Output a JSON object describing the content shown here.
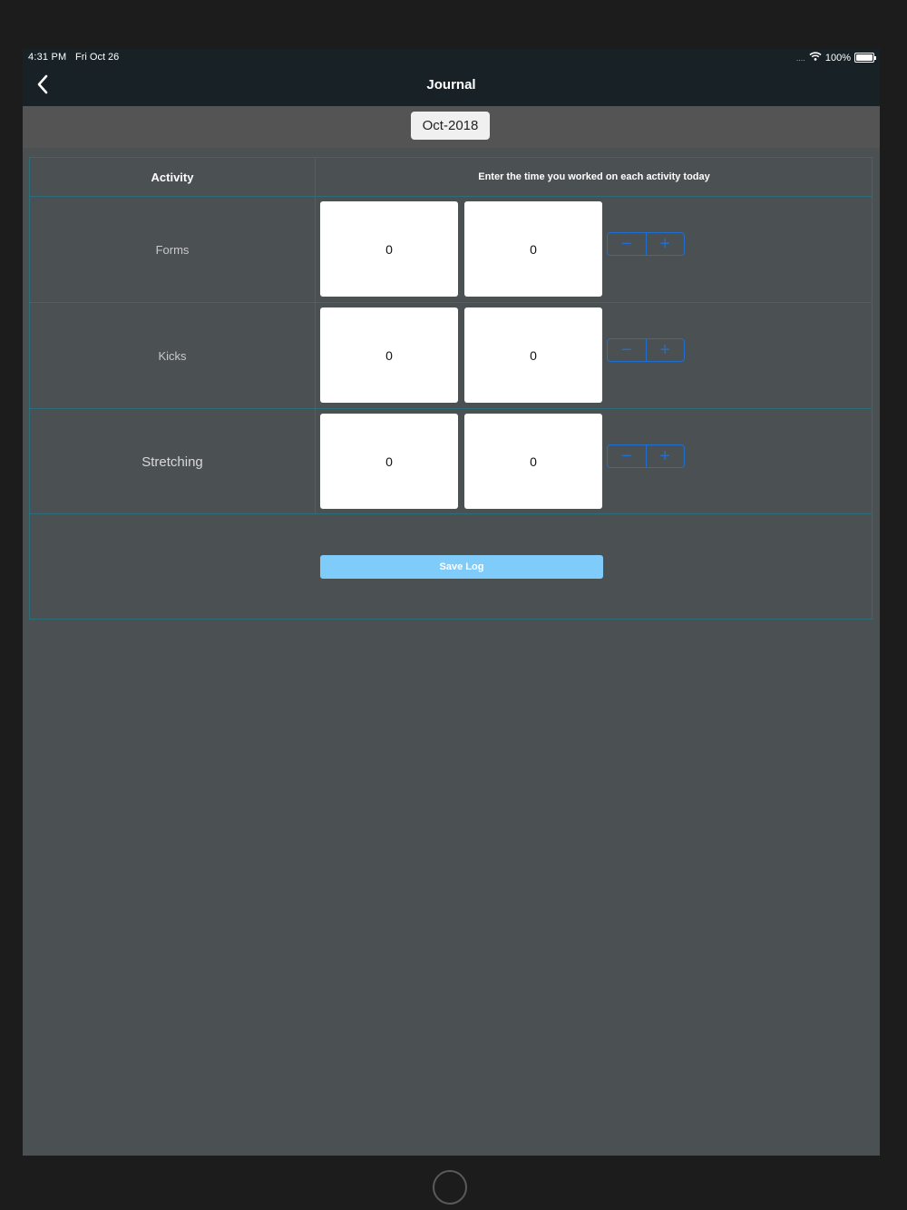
{
  "status_bar": {
    "time": "4:31 PM",
    "date": "Fri Oct 26",
    "signal": "....",
    "battery_percent": "100%",
    "wifi_icon": "wifi-icon",
    "battery_icon": "battery-icon"
  },
  "navbar": {
    "back_icon": "chevron-left-icon",
    "title": "Journal"
  },
  "month_selector": {
    "value": "Oct-2018"
  },
  "table": {
    "header_activity": "Activity",
    "header_instruction": "Enter the time you worked on each activity today",
    "rows": [
      {
        "activity": "Forms",
        "value1": "0",
        "value2": "0"
      },
      {
        "activity": "Kicks",
        "value1": "0",
        "value2": "0"
      },
      {
        "activity": "Stretching",
        "value1": "0",
        "value2": "0"
      }
    ],
    "stepper_minus": "−",
    "stepper_plus": "+"
  },
  "save_button": {
    "label": "Save Log"
  },
  "colors": {
    "background": "#4b5053",
    "navbar": "#182125",
    "grid_line": "#2b6d7a",
    "accent": "#1e6fd0",
    "save_button": "#7fcbf9"
  }
}
